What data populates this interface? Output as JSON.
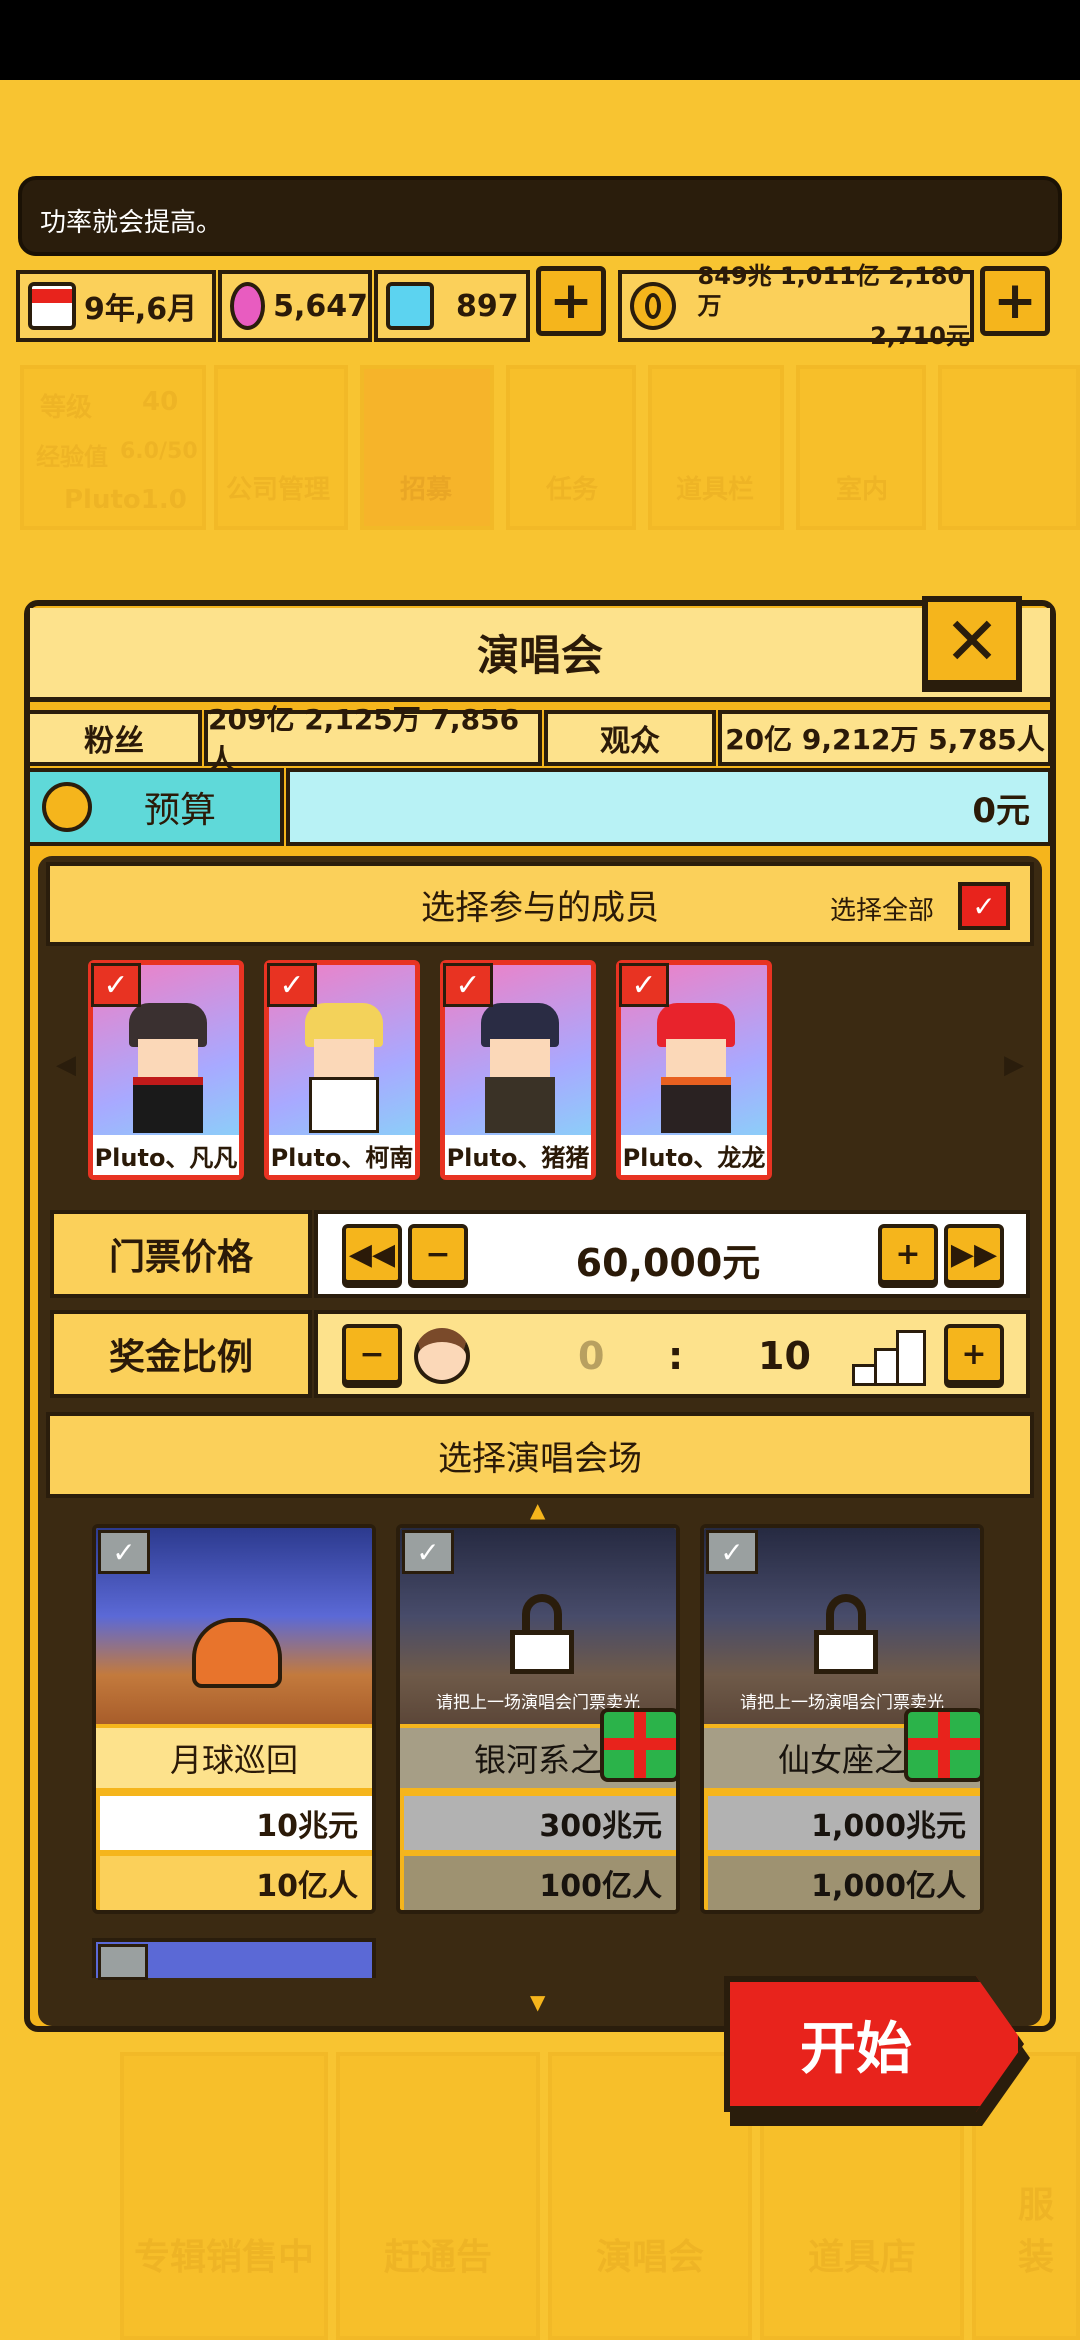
{
  "ticker": {
    "text": "功率就会提高。"
  },
  "resources": {
    "date": "9年,6月",
    "gems_pink": "5,647",
    "gems_blue": "897",
    "money_line1": "849兆 1,011亿 2,180万",
    "money_line2": "2,710元"
  },
  "background": {
    "level_label": "等级",
    "level_value": "40",
    "exp_label": "经验值",
    "exp_value": "6.0/50",
    "company_name": "Pluto1.0",
    "nav": [
      "公司管理",
      "招募",
      "任务",
      "道具栏",
      "室内"
    ],
    "bottom_tabs": [
      "专辑销售中",
      "赶通告",
      "演唱会",
      "道具店",
      "服装"
    ]
  },
  "dialog": {
    "title": "演唱会",
    "fans_label": "粉丝",
    "fans_value": "209亿 2,125万 7,856人",
    "audience_label": "观众",
    "audience_value": "20亿 9,212万 5,785人",
    "budget_label": "预算",
    "budget_value": "0元",
    "members_header": "选择参与的成员",
    "select_all_label": "选择全部",
    "members": [
      {
        "name": "Pluto、凡凡",
        "hair": "#3a3030"
      },
      {
        "name": "Pluto、柯南",
        "hair": "#f3d25a"
      },
      {
        "name": "Pluto、猪猪",
        "hair": "#2a2c44"
      },
      {
        "name": "Pluto、龙龙",
        "hair": "#e8232c"
      }
    ],
    "ticket_label": "门票价格",
    "ticket_value": "60,000元",
    "bonus_label": "奖金比例",
    "bonus_left": "0",
    "bonus_sep": ":",
    "bonus_right": "10",
    "venue_header": "选择演唱会场",
    "venues": [
      {
        "name": "月球巡回",
        "cost": "10兆元",
        "audience": "10亿人",
        "locked": false
      },
      {
        "name": "银河系之",
        "cost": "300兆元",
        "audience": "100亿人",
        "locked": true,
        "lock_text": "请把上一场演唱会门票卖光"
      },
      {
        "name": "仙女座之",
        "cost": "1,000兆元",
        "audience": "1,000亿人",
        "locked": true,
        "lock_text": "请把上一场演唱会门票卖光"
      }
    ],
    "start_label": "开始"
  }
}
